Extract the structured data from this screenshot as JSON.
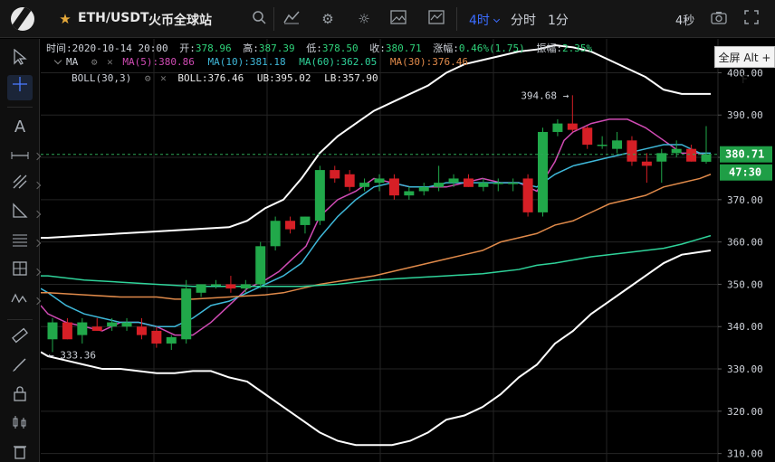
{
  "toolbar": {
    "symbol": "ETH/USDT",
    "exchange": "火币全球站",
    "timeframe_active": "4时",
    "timeframe_minute": "分时",
    "timeframe_1m": "1分",
    "countdown": "4秒",
    "fullscreen_tooltip": "全屏 Alt + F",
    "accent": "#3b6cff"
  },
  "ohlc": {
    "time_label": "时间:",
    "time": "2020-10-14 20:00",
    "open_label": "开:",
    "open": "378.96",
    "high_label": "高:",
    "high": "387.39",
    "low_label": "低:",
    "low": "378.50",
    "close_label": "收:",
    "close": "380.71",
    "change_label": "涨幅:",
    "change": "0.46%(1.75)",
    "amplitude_label": "振幅:",
    "amplitude": "2.35%"
  },
  "indicators": {
    "ma_name": "MA",
    "ma5": "MA(5):380.86",
    "ma10": "MA(10):381.18",
    "ma60": "MA(60):362.05",
    "ma30": "MA(30):376.46",
    "boll_name": "BOLL(30,3)",
    "boll": "BOLL:376.46",
    "ub": "UB:395.02",
    "lb": "LB:357.90"
  },
  "annotations": {
    "high_marker": "394.68",
    "low_marker": "333.36",
    "current_price": "380.71",
    "countdown_tag": "47:30"
  },
  "colors": {
    "up": "#21a84a",
    "down": "#d61f26",
    "ma5": "#d04bb4",
    "ma10": "#3fb8d9",
    "ma60": "#2fd39a",
    "ma30": "#e08a4a",
    "boll": "#ffffff",
    "grid": "#242424"
  },
  "chart_data": {
    "type": "candlestick",
    "y_ticks": [
      "400.00",
      "390.00",
      "380.00",
      "370.00",
      "360.00",
      "350.00",
      "340.00",
      "330.00",
      "320.00",
      "310.00"
    ],
    "ylim": [
      308,
      408
    ],
    "candles": [
      {
        "o": 337,
        "h": 342,
        "l": 334,
        "c": 341
      },
      {
        "o": 341,
        "h": 342,
        "l": 337,
        "c": 337
      },
      {
        "o": 338,
        "h": 342,
        "l": 336,
        "c": 341
      },
      {
        "o": 340,
        "h": 342,
        "l": 339,
        "c": 339
      },
      {
        "o": 340,
        "h": 342,
        "l": 339,
        "c": 341
      },
      {
        "o": 340,
        "h": 342,
        "l": 339,
        "c": 341
      },
      {
        "o": 340,
        "h": 342,
        "l": 337,
        "c": 338
      },
      {
        "o": 339,
        "h": 340,
        "l": 335,
        "c": 336
      },
      {
        "o": 336,
        "h": 338,
        "l": 334.5,
        "c": 337.5
      },
      {
        "o": 337,
        "h": 351,
        "l": 336,
        "c": 349
      },
      {
        "o": 348,
        "h": 350,
        "l": 347,
        "c": 350
      },
      {
        "o": 350,
        "h": 351,
        "l": 349,
        "c": 350
      },
      {
        "o": 350,
        "h": 352,
        "l": 348,
        "c": 349
      },
      {
        "o": 349,
        "h": 351,
        "l": 348,
        "c": 350
      },
      {
        "o": 350,
        "h": 360,
        "l": 349,
        "c": 359
      },
      {
        "o": 359,
        "h": 366,
        "l": 358,
        "c": 365
      },
      {
        "o": 365,
        "h": 366,
        "l": 362,
        "c": 363
      },
      {
        "o": 364,
        "h": 366,
        "l": 362,
        "c": 366
      },
      {
        "o": 365,
        "h": 378,
        "l": 364,
        "c": 377
      },
      {
        "o": 377,
        "h": 378,
        "l": 374,
        "c": 375
      },
      {
        "o": 376,
        "h": 377,
        "l": 372,
        "c": 373
      },
      {
        "o": 373,
        "h": 375,
        "l": 372,
        "c": 374
      },
      {
        "o": 374,
        "h": 376,
        "l": 372,
        "c": 375
      },
      {
        "o": 375,
        "h": 376,
        "l": 370,
        "c": 371
      },
      {
        "o": 371,
        "h": 373,
        "l": 370,
        "c": 372
      },
      {
        "o": 372,
        "h": 374,
        "l": 371,
        "c": 373
      },
      {
        "o": 373,
        "h": 378,
        "l": 372,
        "c": 374
      },
      {
        "o": 374,
        "h": 376,
        "l": 373,
        "c": 375
      },
      {
        "o": 375,
        "h": 376,
        "l": 373,
        "c": 373
      },
      {
        "o": 373,
        "h": 375,
        "l": 372,
        "c": 374
      },
      {
        "o": 374,
        "h": 375,
        "l": 372,
        "c": 374
      },
      {
        "o": 374,
        "h": 375,
        "l": 372,
        "c": 374
      },
      {
        "o": 375,
        "h": 376,
        "l": 366,
        "c": 367
      },
      {
        "o": 367,
        "h": 387,
        "l": 366,
        "c": 386
      },
      {
        "o": 386,
        "h": 389,
        "l": 385,
        "c": 388
      },
      {
        "o": 388,
        "h": 394.68,
        "l": 386,
        "c": 386.5
      },
      {
        "o": 387,
        "h": 387.5,
        "l": 382,
        "c": 383
      },
      {
        "o": 383,
        "h": 385,
        "l": 382,
        "c": 383
      },
      {
        "o": 382,
        "h": 386,
        "l": 381,
        "c": 384
      },
      {
        "o": 384,
        "h": 385,
        "l": 378,
        "c": 379
      },
      {
        "o": 379,
        "h": 381,
        "l": 374,
        "c": 378
      },
      {
        "o": 379,
        "h": 382,
        "l": 374,
        "c": 381
      },
      {
        "o": 381,
        "h": 384,
        "l": 380,
        "c": 382
      },
      {
        "o": 382,
        "h": 383,
        "l": 379,
        "c": 379
      },
      {
        "o": 378.96,
        "h": 387.39,
        "l": 378.5,
        "c": 380.71
      }
    ],
    "lines": [
      {
        "key": "ma5",
        "pts": [
          [
            -8,
            345
          ],
          [
            0,
            343
          ],
          [
            20,
            341
          ],
          [
            40,
            340
          ],
          [
            60,
            339
          ],
          [
            80,
            341
          ],
          [
            100,
            341
          ],
          [
            120,
            340
          ],
          [
            140,
            338
          ],
          [
            160,
            338
          ],
          [
            180,
            341
          ],
          [
            200,
            345
          ],
          [
            220,
            349
          ],
          [
            240,
            351
          ],
          [
            255,
            353
          ],
          [
            270,
            356
          ],
          [
            285,
            359
          ],
          [
            300,
            366
          ],
          [
            320,
            370
          ],
          [
            340,
            372
          ],
          [
            360,
            375
          ],
          [
            380,
            374
          ],
          [
            400,
            373
          ],
          [
            420,
            373
          ],
          [
            440,
            373
          ],
          [
            460,
            374
          ],
          [
            480,
            375
          ],
          [
            500,
            374
          ],
          [
            520,
            374
          ],
          [
            540,
            372
          ],
          [
            560,
            379
          ],
          [
            570,
            384
          ],
          [
            580,
            386
          ],
          [
            600,
            388
          ],
          [
            620,
            389
          ],
          [
            640,
            389
          ],
          [
            660,
            387
          ],
          [
            680,
            384
          ],
          [
            700,
            381
          ],
          [
            720,
            381
          ],
          [
            732,
            380
          ]
        ]
      },
      {
        "key": "ma10",
        "pts": [
          [
            -8,
            349
          ],
          [
            0,
            348
          ],
          [
            20,
            345
          ],
          [
            40,
            343
          ],
          [
            60,
            342
          ],
          [
            80,
            341
          ],
          [
            100,
            341
          ],
          [
            120,
            340
          ],
          [
            140,
            340
          ],
          [
            160,
            342
          ],
          [
            180,
            345
          ],
          [
            200,
            346
          ],
          [
            220,
            348
          ],
          [
            240,
            350
          ],
          [
            260,
            352
          ],
          [
            280,
            355
          ],
          [
            300,
            361
          ],
          [
            320,
            366
          ],
          [
            340,
            370
          ],
          [
            360,
            373
          ],
          [
            380,
            374
          ],
          [
            400,
            373
          ],
          [
            420,
            373
          ],
          [
            440,
            374
          ],
          [
            460,
            374
          ],
          [
            480,
            374
          ],
          [
            500,
            374
          ],
          [
            520,
            374
          ],
          [
            540,
            373
          ],
          [
            560,
            376
          ],
          [
            580,
            378
          ],
          [
            600,
            379
          ],
          [
            620,
            380
          ],
          [
            640,
            381
          ],
          [
            660,
            382
          ],
          [
            680,
            383
          ],
          [
            700,
            383
          ],
          [
            720,
            381
          ],
          [
            732,
            381
          ]
        ]
      },
      {
        "key": "ma30",
        "pts": [
          [
            -8,
            348
          ],
          [
            0,
            348
          ],
          [
            40,
            347.5
          ],
          [
            80,
            347
          ],
          [
            120,
            347
          ],
          [
            140,
            346.5
          ],
          [
            160,
            346.5
          ],
          [
            200,
            347
          ],
          [
            240,
            347.5
          ],
          [
            260,
            348
          ],
          [
            300,
            350
          ],
          [
            330,
            351
          ],
          [
            360,
            352
          ],
          [
            400,
            354
          ],
          [
            440,
            356
          ],
          [
            460,
            357
          ],
          [
            480,
            358
          ],
          [
            500,
            360
          ],
          [
            520,
            361
          ],
          [
            540,
            362
          ],
          [
            560,
            364
          ],
          [
            580,
            365
          ],
          [
            600,
            367
          ],
          [
            620,
            369
          ],
          [
            640,
            370
          ],
          [
            660,
            371
          ],
          [
            680,
            373
          ],
          [
            700,
            374
          ],
          [
            720,
            375
          ],
          [
            732,
            376
          ]
        ]
      },
      {
        "key": "ma60",
        "pts": [
          [
            -8,
            352
          ],
          [
            0,
            352
          ],
          [
            40,
            351
          ],
          [
            80,
            350.5
          ],
          [
            120,
            350
          ],
          [
            160,
            349.5
          ],
          [
            200,
            349.5
          ],
          [
            240,
            349.5
          ],
          [
            280,
            349.5
          ],
          [
            320,
            350
          ],
          [
            360,
            351
          ],
          [
            400,
            351.5
          ],
          [
            440,
            352
          ],
          [
            480,
            352.5
          ],
          [
            500,
            353
          ],
          [
            520,
            353.5
          ],
          [
            540,
            354.5
          ],
          [
            560,
            355
          ],
          [
            600,
            356.5
          ],
          [
            640,
            357.5
          ],
          [
            680,
            358.5
          ],
          [
            700,
            359.5
          ],
          [
            732,
            361.5
          ]
        ]
      },
      {
        "key": "boll",
        "pts": [
          [
            -8,
            361
          ],
          [
            0,
            361
          ],
          [
            40,
            361.5
          ],
          [
            80,
            362
          ],
          [
            120,
            362.5
          ],
          [
            160,
            363
          ],
          [
            200,
            363.5
          ],
          [
            220,
            365
          ],
          [
            240,
            368
          ],
          [
            260,
            370
          ],
          [
            280,
            375
          ],
          [
            300,
            381
          ],
          [
            320,
            385
          ],
          [
            340,
            388
          ],
          [
            360,
            391
          ],
          [
            380,
            393
          ],
          [
            400,
            395
          ],
          [
            420,
            397
          ],
          [
            440,
            400
          ],
          [
            460,
            402
          ],
          [
            480,
            403
          ],
          [
            500,
            404
          ],
          [
            520,
            405
          ],
          [
            540,
            405.5
          ],
          [
            560,
            406.5
          ],
          [
            580,
            406
          ],
          [
            600,
            405
          ],
          [
            620,
            403
          ],
          [
            640,
            401
          ],
          [
            660,
            399
          ],
          [
            680,
            396
          ],
          [
            700,
            395
          ],
          [
            720,
            395
          ],
          [
            732,
            395
          ]
        ]
      },
      {
        "key": "boll",
        "pts": [
          [
            -8,
            334
          ],
          [
            0,
            333
          ],
          [
            20,
            332
          ],
          [
            40,
            331
          ],
          [
            60,
            330
          ],
          [
            80,
            330
          ],
          [
            100,
            329.5
          ],
          [
            120,
            329
          ],
          [
            140,
            329
          ],
          [
            160,
            329.5
          ],
          [
            180,
            329.5
          ],
          [
            200,
            328
          ],
          [
            220,
            327
          ],
          [
            240,
            324
          ],
          [
            260,
            321
          ],
          [
            280,
            318
          ],
          [
            300,
            315
          ],
          [
            320,
            313
          ],
          [
            340,
            312
          ],
          [
            360,
            312
          ],
          [
            380,
            312
          ],
          [
            400,
            313
          ],
          [
            420,
            315
          ],
          [
            440,
            318
          ],
          [
            460,
            319
          ],
          [
            480,
            321
          ],
          [
            500,
            324
          ],
          [
            520,
            328
          ],
          [
            540,
            331
          ],
          [
            560,
            336
          ],
          [
            580,
            339
          ],
          [
            600,
            343
          ],
          [
            620,
            346
          ],
          [
            640,
            349
          ],
          [
            660,
            352
          ],
          [
            680,
            355
          ],
          [
            700,
            357
          ],
          [
            732,
            358
          ]
        ]
      }
    ]
  }
}
